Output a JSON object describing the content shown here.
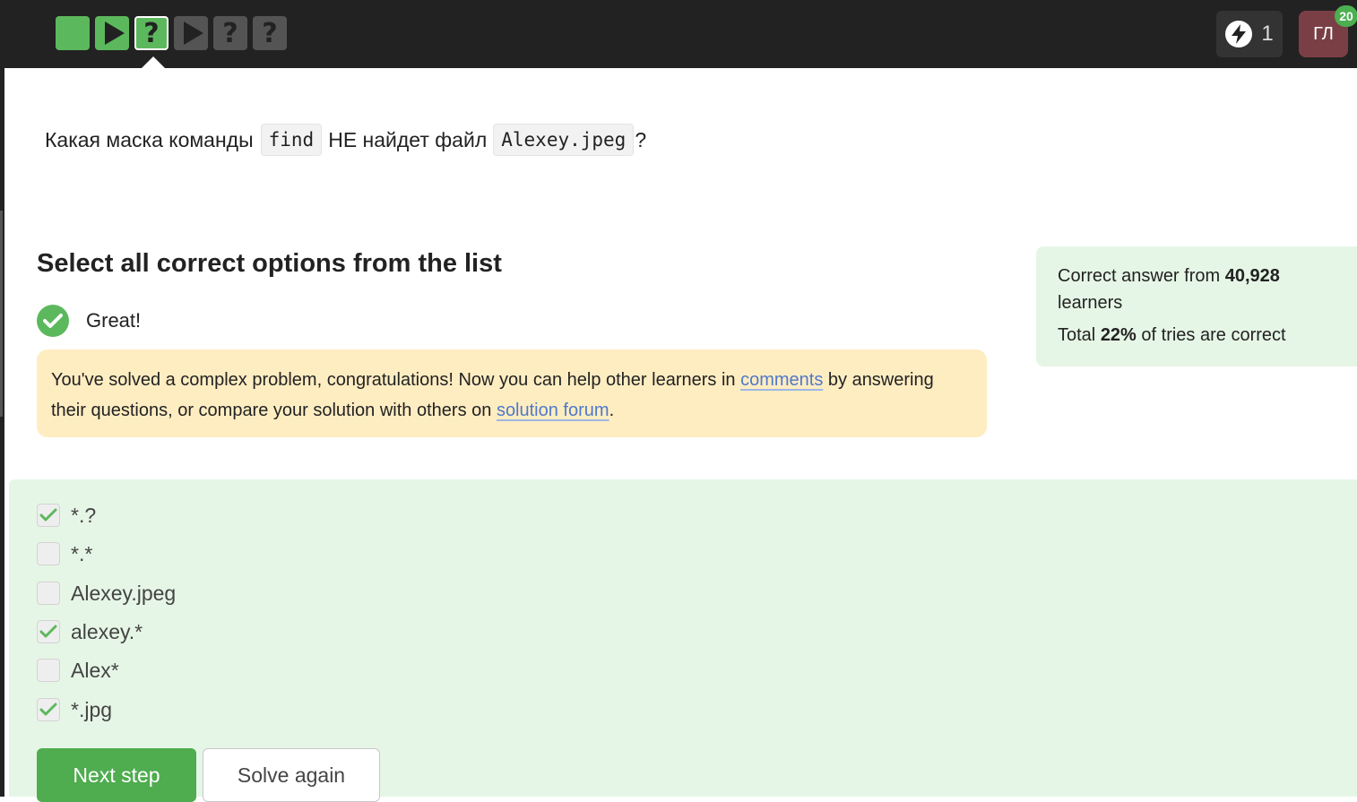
{
  "topbar": {
    "steps": [
      {
        "type": "done",
        "icon": "blank-icon",
        "color": "#5cb85c",
        "glyph": ""
      },
      {
        "type": "done",
        "icon": "play-icon",
        "color": "#5cb85c",
        "glyph": ""
      },
      {
        "type": "current",
        "icon": "question-icon",
        "color": "#5cb85c",
        "glyph": "?"
      },
      {
        "type": "pending",
        "icon": "play-icon",
        "color": "#545454",
        "glyph": ""
      },
      {
        "type": "pending",
        "icon": "question-icon",
        "color": "#545454",
        "glyph": "?"
      },
      {
        "type": "pending",
        "icon": "question-icon",
        "color": "#545454",
        "glyph": "?"
      }
    ],
    "energy": {
      "icon": "lightning-icon",
      "count": "1"
    },
    "avatar": {
      "initials": "ГЛ",
      "badge": "20",
      "color": "#7a3f45"
    }
  },
  "question": {
    "text_before": "Какая маска команды",
    "code_1": "find",
    "text_middle": "НЕ найдет файл",
    "code_2": "Alexey.jpeg",
    "text_after": "?"
  },
  "instructions": "Select all correct options from the list",
  "feedback": {
    "icon": "check-circle-icon",
    "status": "Great!",
    "hint_part1": "You've solved a complex problem, congratulations! Now you can help other learners in ",
    "link_comments": "comments",
    "hint_part2": " by answering their questions, or compare your solution with others on ",
    "link_forum": "solution forum",
    "hint_part3": "."
  },
  "stats": {
    "line1_prefix": "Correct answer from ",
    "learners_count": "40,928",
    "line1_suffix": "learners",
    "line2_prefix": "Total ",
    "percent": "22%",
    "line2_suffix": " of tries are correct"
  },
  "options": [
    {
      "label": "*.?",
      "checked": true
    },
    {
      "label": "*.*",
      "checked": false
    },
    {
      "label": "Alexey.jpeg",
      "checked": false
    },
    {
      "label": "alexey.*",
      "checked": true
    },
    {
      "label": "Alex*",
      "checked": false
    },
    {
      "label": "*.jpg",
      "checked": true
    }
  ],
  "buttons": {
    "next": "Next step",
    "again": "Solve again"
  },
  "colors": {
    "topbar": "#222222",
    "success": "#5cb85c",
    "answers_bg": "#e6f6e6",
    "hint_bg": "#ffedc2",
    "link": "#4f79c9"
  }
}
